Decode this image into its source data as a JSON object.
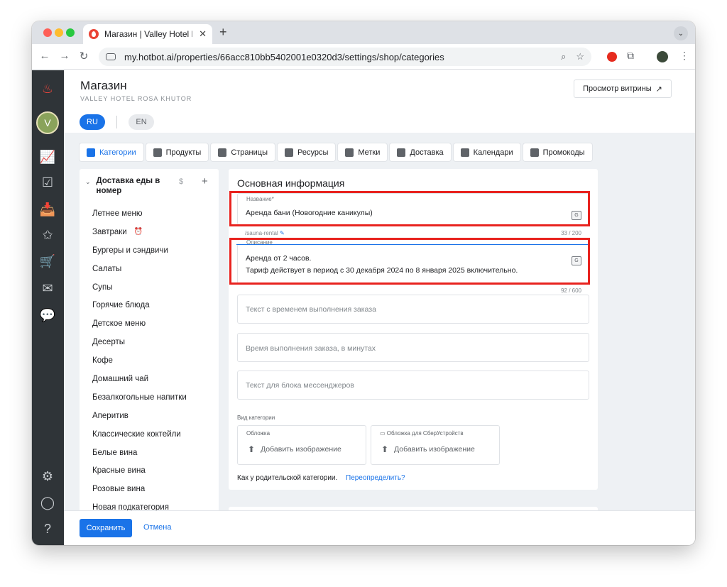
{
  "browser": {
    "tab_title": "Магазин | Valley Hotel Rosa K",
    "url": "my.hotbot.ai/properties/66acc810bb5402001e0320d3/settings/shop/categories"
  },
  "header": {
    "title": "Магазин",
    "subtitle": "VALLEY HOTEL ROSA KHUTOR",
    "storefront_button": "Просмотр витрины"
  },
  "languages": [
    "RU",
    "EN"
  ],
  "shop_tabs": [
    {
      "label": "Категории",
      "icon": "store-icon"
    },
    {
      "label": "Продукты",
      "icon": "grid-icon"
    },
    {
      "label": "Страницы",
      "icon": "page-icon"
    },
    {
      "label": "Ресурсы",
      "icon": "id-card-icon"
    },
    {
      "label": "Метки",
      "icon": "tag-icon"
    },
    {
      "label": "Доставка",
      "icon": "truck-icon"
    },
    {
      "label": "Календари",
      "icon": "calendar-icon"
    },
    {
      "label": "Промокоды",
      "icon": "promo-icon"
    }
  ],
  "categories": {
    "parent": "Доставка еды в номер",
    "items": [
      "Летнее меню",
      "Завтраки",
      "Бургеры и сэндвичи",
      "Салаты",
      "Супы",
      "Горячие блюда",
      "Детское меню",
      "Десерты",
      "Кофе",
      "Домашний чай",
      "Безалкогольные напитки",
      "Аперитив",
      "Классические коктейли",
      "Белые вина",
      "Красные вина",
      "Розовые вина",
      "Новая подкатегория"
    ]
  },
  "form": {
    "section_title": "Основная информация",
    "name_label": "Название*",
    "name_value": "Аренда бани (Новогодние каникулы)",
    "slug": "/sauna-rental",
    "name_counter": "33 / 200",
    "description_label": "Описание",
    "description_line1": "Аренда от 2 часов.",
    "description_line2": "Тариф действует в период с 30 декабря 2024 по 8 января 2025 включительно.",
    "description_counter": "92 / 600",
    "order_time_text_placeholder": "Текст с временем выполнения заказа",
    "order_time_minutes_placeholder": "Время выполнения заказа, в минутах",
    "messenger_text_placeholder": "Текст для блока мессенджеров",
    "category_view_label": "Вид категории",
    "cover_label": "Обложка",
    "sber_cover_label": "Обложка для СберУстройств",
    "add_image": "Добавить изображение",
    "inherit_text": "Как у родительской категории.",
    "override_link": "Переопределить?"
  },
  "footer": {
    "save": "Сохранить",
    "cancel": "Отмена"
  },
  "colors": {
    "accent": "#1a73e8",
    "highlight": "#e8231f",
    "sidebar": "#2f3438"
  }
}
